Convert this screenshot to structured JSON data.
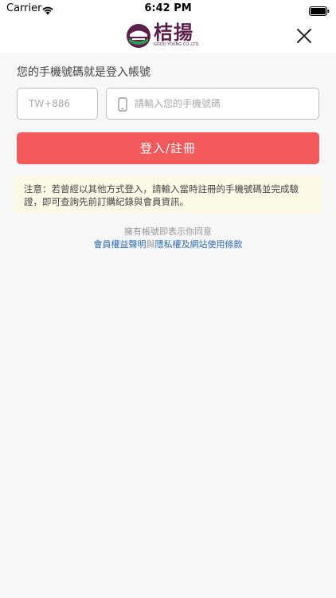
{
  "status_bar": {
    "carrier": "Carrier",
    "time": "6:42 PM"
  },
  "header": {
    "brand_name": "桔揚",
    "brand_subtitle": "GOOD YOUNG CO.,LTD.",
    "close_icon": "close-icon"
  },
  "form": {
    "prompt": "您的手機號碼就是登入帳號",
    "country_code_placeholder": "TW+886",
    "phone_placeholder": "請輸入您的手機號碼",
    "submit_label": "登入/註冊"
  },
  "notice": {
    "text": "注意：若曾經以其他方式登入，請輸入當時註冊的手機號碼並完成驗證，即可查詢先前訂購紀錄與會員資訊。"
  },
  "footer": {
    "agree_text": "擁有帳號即表示你同意",
    "member_terms_link": "會員權益聲明",
    "joiner": "與",
    "privacy_link": "隱私權及網站使用條款"
  },
  "colors": {
    "primary_button": "#f35a5c",
    "brand": "#5a1f4a",
    "link": "#2d6db5",
    "notice_bg": "#fcf9e6"
  }
}
